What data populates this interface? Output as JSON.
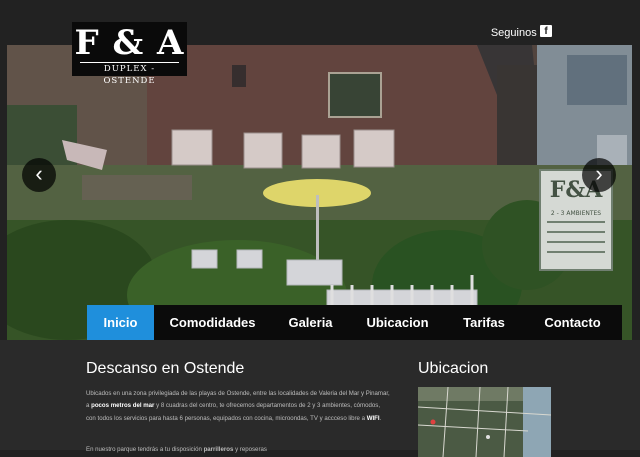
{
  "brand": {
    "mark": "F & A",
    "subtitle": "DUPLEX - OSTENDE"
  },
  "social": {
    "follow_label": "Seguinos en",
    "facebook_glyph": "f"
  },
  "slider": {
    "prev_glyph": "‹",
    "next_glyph": "›",
    "sign_title": "F&A",
    "sign_sub": "2 - 3 AMBIENTES"
  },
  "nav": {
    "items": [
      {
        "label": "Inicio",
        "active": true
      },
      {
        "label": "Comodidades",
        "active": false
      },
      {
        "label": "Galeria",
        "active": false
      },
      {
        "label": "Ubicacion",
        "active": false
      },
      {
        "label": "Tarifas",
        "active": false
      },
      {
        "label": "Contacto",
        "active": false
      }
    ],
    "active_color": "#1f8fdc"
  },
  "main": {
    "heading": "Descanso en Ostende",
    "intro_pre": "Ubicados en una zona privilegiada de las playas de Ostende, entre las localidades de Valeria del Mar y Pinamar, a ",
    "intro_b1": "pocos metros del mar",
    "intro_mid": " y 8 cuadras del centro, te ofrecemos departamentos de 2 y 3 ambientes, cómodos, con todos los servicios para hasta 6 personas, equipados con cocina, microondas, TV y accceso libre a ",
    "intro_b2": "WIFI",
    "intro_end": ".",
    "second_pre": "En nuestro parque tendrás a tu disposición ",
    "second_b": "parrilleros",
    "second_end": " y reposeras"
  },
  "side": {
    "heading": "Ubicacion"
  }
}
